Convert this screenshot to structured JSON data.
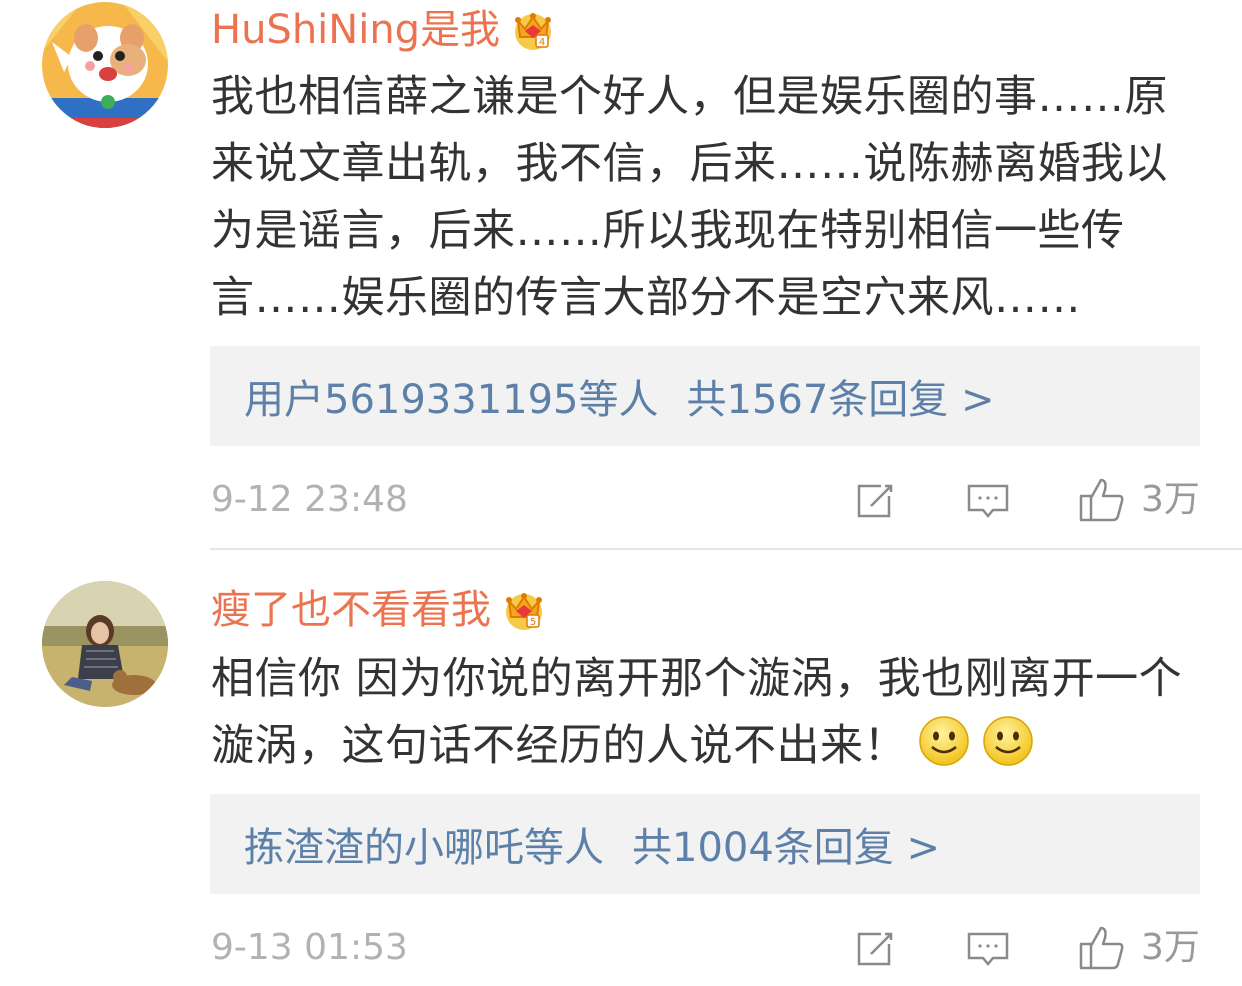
{
  "colors": {
    "username": "#eb7350",
    "link": "#5d80a8",
    "reply_bg": "#f2f2f2",
    "meta": "#b2b2b2"
  },
  "comments": [
    {
      "avatar_icon": "cartoon-hamster-avatar",
      "username": "HuShiNing是我",
      "badge_icon": "crown-vip-icon",
      "text": "我也相信薛之谦是个好人，但是娱乐圈的事……原来说文章出轨，我不信，后来……说陈赫离婚我以为是谣言，后来……所以我现在特别相信一些传言……娱乐圈的传言大部分不是空穴来风……",
      "reply_users": "用户5619331195等人",
      "reply_count": "共1567条回复 >",
      "time": "9-12 23:48",
      "likes": "3万"
    },
    {
      "avatar_icon": "photo-person-with-dog-avatar",
      "username": "瘦了也不看看我",
      "badge_icon": "crown-vip-icon",
      "text": "相信你 因为你说的离开那个漩涡，我也刚离开一个漩涡，这句话不经历的人说不出来！",
      "emojis": [
        "smile-emoji",
        "smile-emoji"
      ],
      "reply_users": "拣渣渣的小哪吒等人",
      "reply_count": "共1004条回复 >",
      "time": "9-13 01:53",
      "likes": "3万"
    }
  ]
}
